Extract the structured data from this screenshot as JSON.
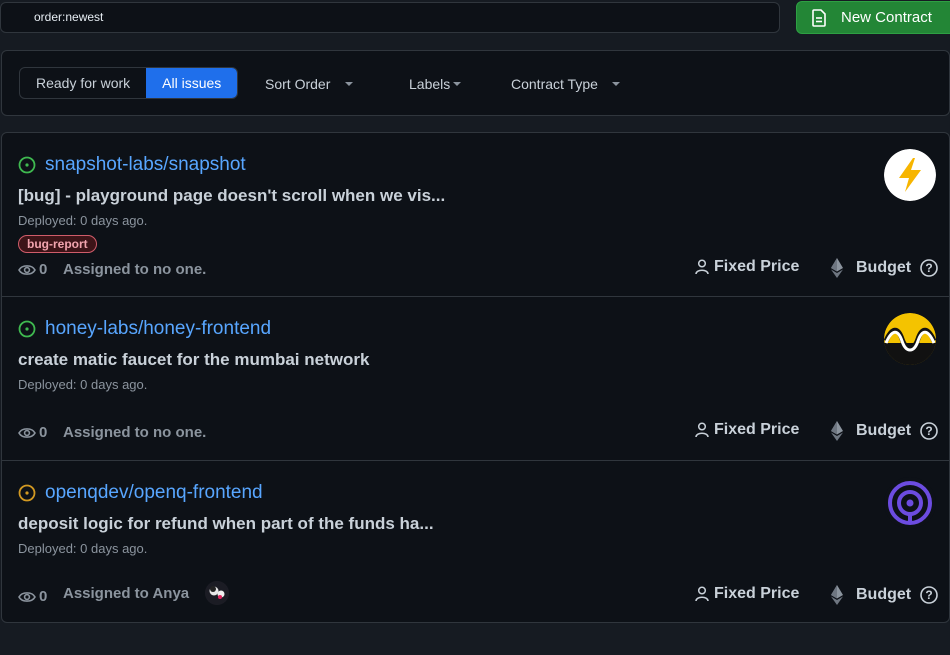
{
  "search": {
    "value": "order:newest"
  },
  "new_contract": {
    "label": "New Contract"
  },
  "filters": {
    "ready_label": "Ready for work",
    "all_label": "All issues",
    "sort_label": "Sort Order",
    "labels_label": "Labels",
    "contract_type_label": "Contract Type"
  },
  "issues": [
    {
      "repo": "snapshot-labs/snapshot",
      "title": "[bug] - playground page doesn't scroll when we vis...",
      "deployed": "Deployed: 0 days ago.",
      "label": "bug-report",
      "watch_count": "0",
      "assigned": "Assigned to no one.",
      "price_type": "Fixed Price",
      "budget": "Budget",
      "status_color": "#3fb950"
    },
    {
      "repo": "honey-labs/honey-frontend",
      "title": "create matic faucet for the mumbai network",
      "deployed": "Deployed: 0 days ago.",
      "watch_count": "0",
      "assigned": "Assigned to no one.",
      "price_type": "Fixed Price",
      "budget": "Budget",
      "status_color": "#3fb950"
    },
    {
      "repo": "openqdev/openq-frontend",
      "title": "deposit logic for refund when part of the funds ha...",
      "deployed": "Deployed: 0 days ago.",
      "watch_count": "0",
      "assigned": "Assigned to Anya",
      "price_type": "Fixed Price",
      "budget": "Budget",
      "status_color": "#d29922"
    }
  ],
  "colors": {
    "accent_blue": "#1f6feb",
    "link_blue": "#58a6ff",
    "success_green": "#238636"
  }
}
